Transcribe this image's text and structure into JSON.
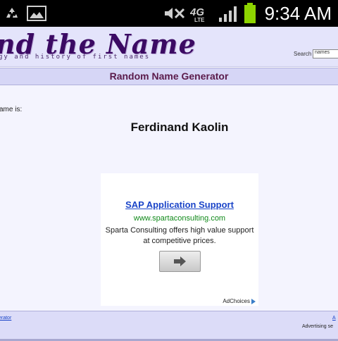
{
  "status_bar": {
    "time": "9:34 AM",
    "network_label": "4G LTE",
    "icons": [
      "recycle-icon",
      "image-icon",
      "mute-icon",
      "network-4g-icon",
      "signal-icon",
      "battery-icon"
    ]
  },
  "header": {
    "logo_text": "nd the Name",
    "tagline": "gy and history of first names",
    "search_label": "Search",
    "search_value": "names"
  },
  "titlebar": {
    "title": "Random Name Generator"
  },
  "main": {
    "lead_text": "ame is:",
    "generated_name": "Ferdinand Kaolin"
  },
  "ad": {
    "title": "SAP Application Support",
    "url": "www.spartaconsulting.com",
    "description": "Sparta Consulting offers high value support at competitive prices.",
    "choices_label": "AdChoices"
  },
  "footer": {
    "left_link": "erator",
    "right_link": "A",
    "advertising_text": "Advertising se"
  },
  "colors": {
    "header_bg": "#e4e4fb",
    "titlebar_bg": "#d6d6f6",
    "title_text": "#5a1a4a",
    "logo": "#3b0a63",
    "link": "#1a44c8",
    "ad_url": "#108a1a",
    "battery": "#8dd400"
  }
}
